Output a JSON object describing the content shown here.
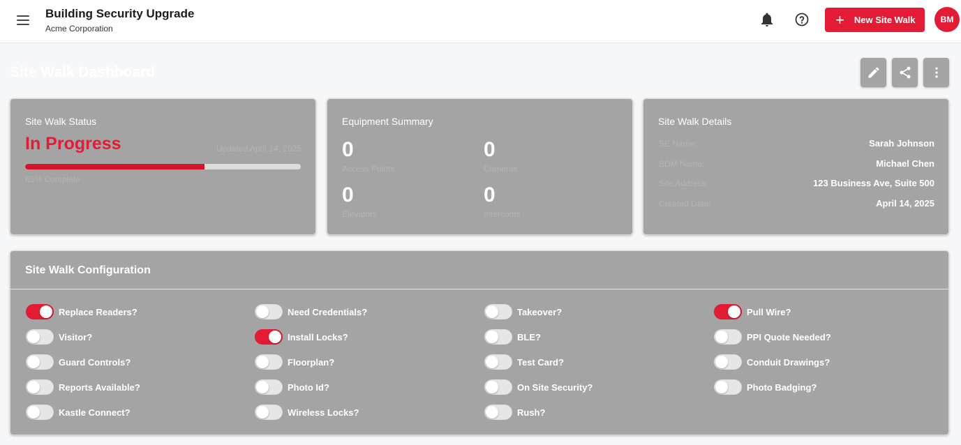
{
  "header": {
    "title": "Building Security Upgrade",
    "subtitle": "Acme Corporation",
    "new_button_label": "New Site Walk",
    "avatar_initials": "BM"
  },
  "dashboard": {
    "title": "Site Walk Dashboard"
  },
  "status_card": {
    "title": "Site Walk Status",
    "status": "In Progress",
    "updated": "Updated April 14, 2025",
    "progress_percent": 65,
    "progress_label": "65% Complete"
  },
  "equipment_card": {
    "title": "Equipment Summary",
    "items": [
      {
        "value": "0",
        "label": "Access Points"
      },
      {
        "value": "0",
        "label": "Cameras"
      },
      {
        "value": "0",
        "label": "Elevators"
      },
      {
        "value": "0",
        "label": "Intercoms"
      }
    ]
  },
  "details_card": {
    "title": "Site Walk Details",
    "rows": [
      {
        "label": "SE Name:",
        "value": "Sarah Johnson"
      },
      {
        "label": "BDM Name:",
        "value": "Michael Chen"
      },
      {
        "label": "Site Address:",
        "value": "123 Business Ave, Suite 500"
      },
      {
        "label": "Created Date:",
        "value": "April 14, 2025"
      }
    ]
  },
  "config": {
    "title": "Site Walk Configuration",
    "toggles": [
      {
        "label": "Replace Readers?",
        "on": true
      },
      {
        "label": "Need Credentials?",
        "on": false
      },
      {
        "label": "Takeover?",
        "on": false
      },
      {
        "label": "Pull Wire?",
        "on": true
      },
      {
        "label": "Visitor?",
        "on": false
      },
      {
        "label": "Install Locks?",
        "on": true
      },
      {
        "label": "BLE?",
        "on": false
      },
      {
        "label": "PPI Quote Needed?",
        "on": false
      },
      {
        "label": "Guard Controls?",
        "on": false
      },
      {
        "label": "Floorplan?",
        "on": false
      },
      {
        "label": "Test Card?",
        "on": false
      },
      {
        "label": "Conduit Drawings?",
        "on": false
      },
      {
        "label": "Reports Available?",
        "on": false
      },
      {
        "label": "Photo Id?",
        "on": false
      },
      {
        "label": "On Site Security?",
        "on": false
      },
      {
        "label": "Photo Badging?",
        "on": false
      },
      {
        "label": "Kastle Connect?",
        "on": false
      },
      {
        "label": "Wireless Locks?",
        "on": false
      },
      {
        "label": "Rush?",
        "on": false
      }
    ]
  },
  "colors": {
    "accent": "#e31b34",
    "card_bg": "#a4a4a4"
  }
}
